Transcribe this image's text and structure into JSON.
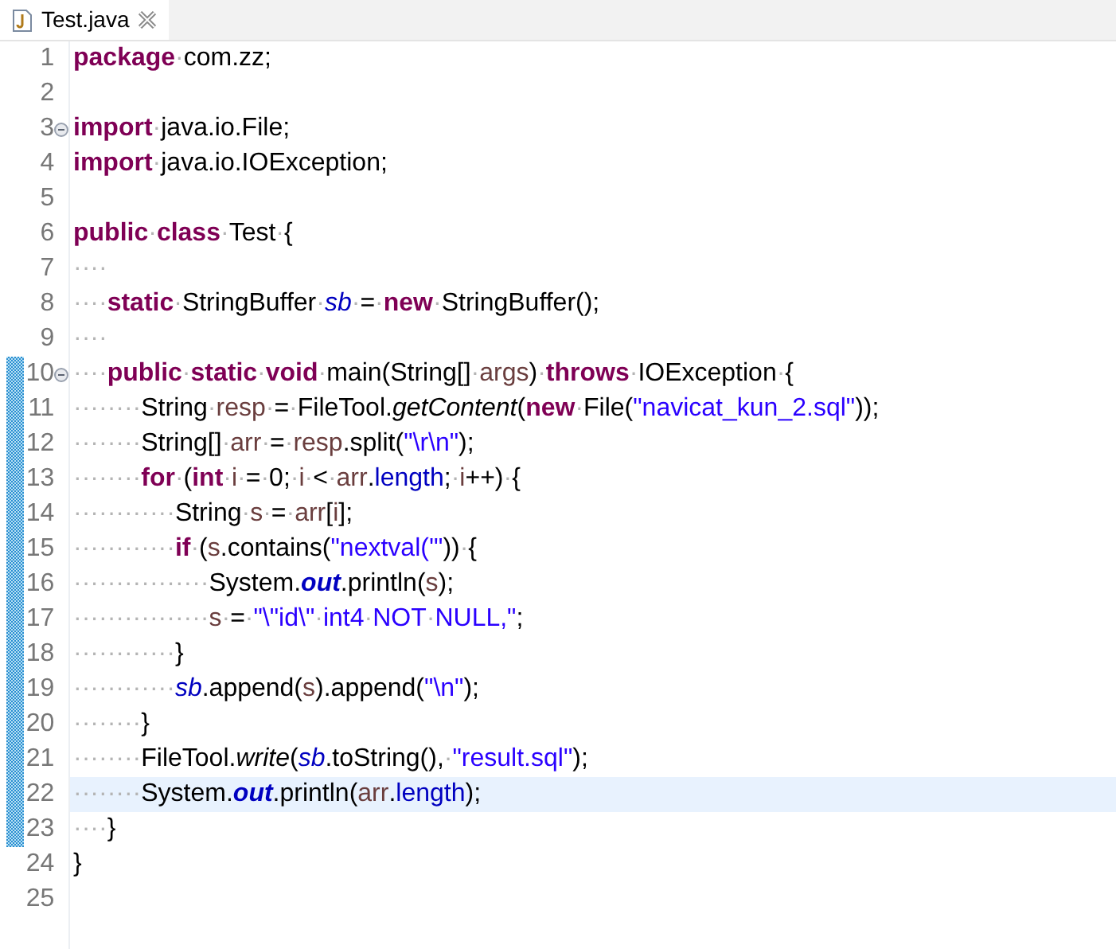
{
  "tabs": [
    {
      "label": "Test.java",
      "selected": true
    }
  ],
  "lines": [
    {
      "number": "1",
      "fold": false,
      "changed": false,
      "current": false,
      "tokens": [
        {
          "kind": "kw",
          "text": "package"
        },
        {
          "kind": "ws",
          "text": "·"
        },
        {
          "kind": "plain",
          "text": "com.zz;"
        }
      ]
    },
    {
      "number": "2",
      "fold": false,
      "changed": false,
      "current": false
    },
    {
      "number": "3",
      "fold": true,
      "changed": false,
      "current": false,
      "tokens": [
        {
          "kind": "kw",
          "text": "import"
        },
        {
          "kind": "ws",
          "text": "·"
        },
        {
          "kind": "plain",
          "text": "java.io.File;"
        }
      ]
    },
    {
      "number": "4",
      "fold": false,
      "changed": false,
      "current": false,
      "tokens": [
        {
          "kind": "kw",
          "text": "import"
        },
        {
          "kind": "ws",
          "text": "·"
        },
        {
          "kind": "plain",
          "text": "java.io.IOException;"
        }
      ]
    },
    {
      "number": "5",
      "fold": false,
      "changed": false,
      "current": false
    },
    {
      "number": "6",
      "fold": false,
      "changed": false,
      "current": false,
      "tokens": [
        {
          "kind": "kw",
          "text": "public"
        },
        {
          "kind": "ws",
          "text": "·"
        },
        {
          "kind": "kw",
          "text": "class"
        },
        {
          "kind": "ws",
          "text": "·"
        },
        {
          "kind": "plain",
          "text": "Test"
        },
        {
          "kind": "ws",
          "text": "·"
        },
        {
          "kind": "plain",
          "text": "{"
        }
      ]
    },
    {
      "number": "7",
      "fold": false,
      "changed": false,
      "current": false,
      "tokens": [
        {
          "kind": "ws",
          "text": "····"
        }
      ]
    },
    {
      "number": "8",
      "fold": false,
      "changed": false,
      "current": false,
      "tokens": [
        {
          "kind": "ws",
          "text": "····"
        },
        {
          "kind": "kw",
          "text": "static"
        },
        {
          "kind": "ws",
          "text": "·"
        },
        {
          "kind": "plain",
          "text": "StringBuffer"
        },
        {
          "kind": "ws",
          "text": "·"
        },
        {
          "kind": "field",
          "text": "sb"
        },
        {
          "kind": "ws",
          "text": "·"
        },
        {
          "kind": "plain",
          "text": "="
        },
        {
          "kind": "ws",
          "text": "·"
        },
        {
          "kind": "kw",
          "text": "new"
        },
        {
          "kind": "ws",
          "text": "·"
        },
        {
          "kind": "plain",
          "text": "StringBuffer();"
        }
      ]
    },
    {
      "number": "9",
      "fold": false,
      "changed": false,
      "current": false,
      "tokens": [
        {
          "kind": "ws",
          "text": "····"
        }
      ]
    },
    {
      "number": "10",
      "fold": true,
      "changed": true,
      "current": false,
      "tokens": [
        {
          "kind": "ws",
          "text": "····"
        },
        {
          "kind": "kw",
          "text": "public"
        },
        {
          "kind": "ws",
          "text": "·"
        },
        {
          "kind": "kw",
          "text": "static"
        },
        {
          "kind": "ws",
          "text": "·"
        },
        {
          "kind": "kw",
          "text": "void"
        },
        {
          "kind": "ws",
          "text": "·"
        },
        {
          "kind": "plain",
          "text": "main(String[]"
        },
        {
          "kind": "ws",
          "text": "·"
        },
        {
          "kind": "var",
          "text": "args"
        },
        {
          "kind": "plain",
          "text": ")"
        },
        {
          "kind": "ws",
          "text": "·"
        },
        {
          "kind": "kw",
          "text": "throws"
        },
        {
          "kind": "ws",
          "text": "·"
        },
        {
          "kind": "plain",
          "text": "IOException"
        },
        {
          "kind": "ws",
          "text": "·"
        },
        {
          "kind": "plain",
          "text": "{"
        }
      ]
    },
    {
      "number": "11",
      "fold": false,
      "changed": true,
      "current": false,
      "tokens": [
        {
          "kind": "ws",
          "text": "········"
        },
        {
          "kind": "plain",
          "text": "String"
        },
        {
          "kind": "ws",
          "text": "·"
        },
        {
          "kind": "var",
          "text": "resp"
        },
        {
          "kind": "ws",
          "text": "·"
        },
        {
          "kind": "plain",
          "text": "="
        },
        {
          "kind": "ws",
          "text": "·"
        },
        {
          "kind": "plain",
          "text": "FileTool."
        },
        {
          "kind": "smethod",
          "text": "getContent"
        },
        {
          "kind": "plain",
          "text": "("
        },
        {
          "kind": "kw",
          "text": "new"
        },
        {
          "kind": "ws",
          "text": "·"
        },
        {
          "kind": "plain",
          "text": "File("
        },
        {
          "kind": "str",
          "text": "\"navicat_kun_2.sql\""
        },
        {
          "kind": "plain",
          "text": "));"
        }
      ]
    },
    {
      "number": "12",
      "fold": false,
      "changed": true,
      "current": false,
      "tokens": [
        {
          "kind": "ws",
          "text": "········"
        },
        {
          "kind": "plain",
          "text": "String[]"
        },
        {
          "kind": "ws",
          "text": "·"
        },
        {
          "kind": "var",
          "text": "arr"
        },
        {
          "kind": "ws",
          "text": "·"
        },
        {
          "kind": "plain",
          "text": "="
        },
        {
          "kind": "ws",
          "text": "·"
        },
        {
          "kind": "var",
          "text": "resp"
        },
        {
          "kind": "plain",
          "text": ".split("
        },
        {
          "kind": "str",
          "text": "\"\\r\\n\""
        },
        {
          "kind": "plain",
          "text": ");"
        }
      ]
    },
    {
      "number": "13",
      "fold": false,
      "changed": true,
      "current": false,
      "tokens": [
        {
          "kind": "ws",
          "text": "········"
        },
        {
          "kind": "kw",
          "text": "for"
        },
        {
          "kind": "ws",
          "text": "·"
        },
        {
          "kind": "plain",
          "text": "("
        },
        {
          "kind": "kw",
          "text": "int"
        },
        {
          "kind": "ws",
          "text": "·"
        },
        {
          "kind": "var",
          "text": "i"
        },
        {
          "kind": "ws",
          "text": "·"
        },
        {
          "kind": "plain",
          "text": "="
        },
        {
          "kind": "ws",
          "text": "·"
        },
        {
          "kind": "plain",
          "text": "0;"
        },
        {
          "kind": "ws",
          "text": "·"
        },
        {
          "kind": "var",
          "text": "i"
        },
        {
          "kind": "ws",
          "text": "·"
        },
        {
          "kind": "plain",
          "text": "<"
        },
        {
          "kind": "ws",
          "text": "·"
        },
        {
          "kind": "var",
          "text": "arr"
        },
        {
          "kind": "plain",
          "text": "."
        },
        {
          "kind": "ifield",
          "text": "length"
        },
        {
          "kind": "plain",
          "text": ";"
        },
        {
          "kind": "ws",
          "text": "·"
        },
        {
          "kind": "var",
          "text": "i"
        },
        {
          "kind": "plain",
          "text": "++)"
        },
        {
          "kind": "ws",
          "text": "·"
        },
        {
          "kind": "plain",
          "text": "{"
        }
      ]
    },
    {
      "number": "14",
      "fold": false,
      "changed": true,
      "current": false,
      "tokens": [
        {
          "kind": "ws",
          "text": "············"
        },
        {
          "kind": "plain",
          "text": "String"
        },
        {
          "kind": "ws",
          "text": "·"
        },
        {
          "kind": "var",
          "text": "s"
        },
        {
          "kind": "ws",
          "text": "·"
        },
        {
          "kind": "plain",
          "text": "="
        },
        {
          "kind": "ws",
          "text": "·"
        },
        {
          "kind": "var",
          "text": "arr"
        },
        {
          "kind": "plain",
          "text": "["
        },
        {
          "kind": "var",
          "text": "i"
        },
        {
          "kind": "plain",
          "text": "];"
        }
      ]
    },
    {
      "number": "15",
      "fold": false,
      "changed": true,
      "current": false,
      "tokens": [
        {
          "kind": "ws",
          "text": "············"
        },
        {
          "kind": "kw",
          "text": "if"
        },
        {
          "kind": "ws",
          "text": "·"
        },
        {
          "kind": "plain",
          "text": "("
        },
        {
          "kind": "var",
          "text": "s"
        },
        {
          "kind": "plain",
          "text": ".contains("
        },
        {
          "kind": "str",
          "text": "\"nextval('\""
        },
        {
          "kind": "plain",
          "text": "))"
        },
        {
          "kind": "ws",
          "text": "·"
        },
        {
          "kind": "plain",
          "text": "{"
        }
      ]
    },
    {
      "number": "16",
      "fold": false,
      "changed": true,
      "current": false,
      "tokens": [
        {
          "kind": "ws",
          "text": "················"
        },
        {
          "kind": "plain",
          "text": "System."
        },
        {
          "kind": "sfield",
          "text": "out"
        },
        {
          "kind": "plain",
          "text": ".println("
        },
        {
          "kind": "var",
          "text": "s"
        },
        {
          "kind": "plain",
          "text": ");"
        }
      ]
    },
    {
      "number": "17",
      "fold": false,
      "changed": true,
      "current": false,
      "tokens": [
        {
          "kind": "ws",
          "text": "················"
        },
        {
          "kind": "var",
          "text": "s"
        },
        {
          "kind": "ws",
          "text": "·"
        },
        {
          "kind": "plain",
          "text": "="
        },
        {
          "kind": "ws",
          "text": "·"
        },
        {
          "kind": "str",
          "text": "\"\\\"id\\\""
        },
        {
          "kind": "ws",
          "text": "·"
        },
        {
          "kind": "str",
          "text": "int4"
        },
        {
          "kind": "ws",
          "text": "·"
        },
        {
          "kind": "str",
          "text": "NOT"
        },
        {
          "kind": "ws",
          "text": "·"
        },
        {
          "kind": "str",
          "text": "NULL,\""
        },
        {
          "kind": "plain",
          "text": ";"
        }
      ]
    },
    {
      "number": "18",
      "fold": false,
      "changed": true,
      "current": false,
      "tokens": [
        {
          "kind": "ws",
          "text": "············"
        },
        {
          "kind": "plain",
          "text": "}"
        }
      ]
    },
    {
      "number": "19",
      "fold": false,
      "changed": true,
      "current": false,
      "tokens": [
        {
          "kind": "ws",
          "text": "············"
        },
        {
          "kind": "field",
          "text": "sb"
        },
        {
          "kind": "plain",
          "text": ".append("
        },
        {
          "kind": "var",
          "text": "s"
        },
        {
          "kind": "plain",
          "text": ").append("
        },
        {
          "kind": "str",
          "text": "\"\\n\""
        },
        {
          "kind": "plain",
          "text": ");"
        }
      ]
    },
    {
      "number": "20",
      "fold": false,
      "changed": true,
      "current": false,
      "tokens": [
        {
          "kind": "ws",
          "text": "········"
        },
        {
          "kind": "plain",
          "text": "}"
        }
      ]
    },
    {
      "number": "21",
      "fold": false,
      "changed": true,
      "current": false,
      "tokens": [
        {
          "kind": "ws",
          "text": "········"
        },
        {
          "kind": "plain",
          "text": "FileTool."
        },
        {
          "kind": "smethod",
          "text": "write"
        },
        {
          "kind": "plain",
          "text": "("
        },
        {
          "kind": "field",
          "text": "sb"
        },
        {
          "kind": "plain",
          "text": ".toString(),"
        },
        {
          "kind": "ws",
          "text": "·"
        },
        {
          "kind": "str",
          "text": "\"result.sql\""
        },
        {
          "kind": "plain",
          "text": ");"
        }
      ]
    },
    {
      "number": "22",
      "fold": false,
      "changed": true,
      "current": true,
      "tokens": [
        {
          "kind": "ws",
          "text": "········"
        },
        {
          "kind": "plain",
          "text": "System."
        },
        {
          "kind": "sfield",
          "text": "out"
        },
        {
          "kind": "plain",
          "text": ".println("
        },
        {
          "kind": "var",
          "text": "arr"
        },
        {
          "kind": "plain",
          "text": "."
        },
        {
          "kind": "ifield",
          "text": "length"
        },
        {
          "kind": "plain",
          "text": ");"
        }
      ]
    },
    {
      "number": "23",
      "fold": false,
      "changed": true,
      "current": false,
      "tokens": [
        {
          "kind": "ws",
          "text": "····"
        },
        {
          "kind": "plain",
          "text": "}"
        }
      ]
    },
    {
      "number": "24",
      "fold": false,
      "changed": false,
      "current": false,
      "tokens": [
        {
          "kind": "plain",
          "text": "}"
        }
      ]
    },
    {
      "number": "25",
      "fold": false,
      "changed": false,
      "current": false
    }
  ]
}
